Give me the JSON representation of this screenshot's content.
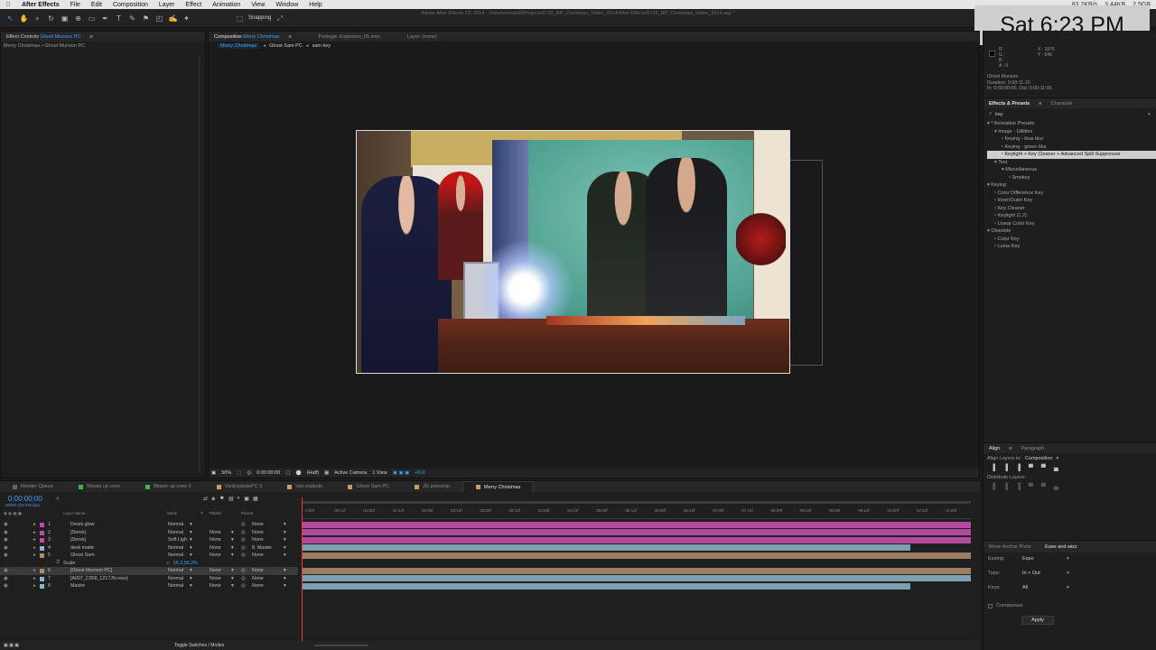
{
  "menubar": {
    "items": [
      "After Effects",
      "File",
      "Edit",
      "Composition",
      "Layer",
      "Effect",
      "Animation",
      "View",
      "Window",
      "Help"
    ],
    "tray": [
      "83.2KB/s",
      "3.44KB",
      "2.5GB"
    ]
  },
  "app": {
    "title": "Adobe After Effects CC 2014 - /Volumes/raid2/Projects/5792_RP_Christmas_Video_2014/After Effects/5792_RP_Christmas_Video_2014.aep *",
    "snapping": "Snapping"
  },
  "clock": "Sat 6:23 PM",
  "effect_controls": {
    "tab": "Effect Controls",
    "tab_sub": "Ghost Munson PC",
    "breadcrumb": "Merry Christmas • Ghost Munson PC"
  },
  "viewer": {
    "tabs": [
      {
        "label": "Composition",
        "sub": "Merry Christmas"
      },
      {
        "label": "Footage: Explosion_01.mov"
      },
      {
        "label": "Layer: (none)"
      }
    ],
    "breadcrumbs": [
      "Merry Christmas",
      "Ghost Sam PC",
      "sam key"
    ],
    "zoom": "50%",
    "timecode": "0:00:00:00",
    "resolution": "(Half)",
    "camera": "Active Camera",
    "views": "1 View",
    "exposure": "+0.0"
  },
  "info": {
    "r": "R :",
    "g": "G :",
    "b": "B :",
    "a": "A : 0",
    "x": "X : 1876",
    "y": "Y : 646",
    "layer": "Ghost Munson",
    "duration": "Duration: 0:00:11:10",
    "inout": "In: 0:00:00:00, Out: 0:00:11:09"
  },
  "effects": {
    "tabs": [
      "Effects & Presets",
      "Character"
    ],
    "search": "key",
    "tree": [
      {
        "label": "* Animation Presets",
        "level": 0,
        "open": true
      },
      {
        "label": "Image - Utilities",
        "level": 1,
        "open": true
      },
      {
        "label": "Keying - blue blur",
        "level": 2
      },
      {
        "label": "Keying - green blur",
        "level": 2
      },
      {
        "label": "Keylight + Key Cleaner + Advanced Spill Suppressor",
        "level": 2,
        "selected": true
      },
      {
        "label": "Text",
        "level": 1,
        "open": true
      },
      {
        "label": "Miscellaneous",
        "level": 2,
        "open": true
      },
      {
        "label": "Smokey",
        "level": 3
      },
      {
        "label": "Keying",
        "level": 0,
        "open": true
      },
      {
        "label": "Color Difference Key",
        "level": 1
      },
      {
        "label": "Inner/Outer Key",
        "level": 1
      },
      {
        "label": "Key Cleaner",
        "level": 1
      },
      {
        "label": "Keylight (1.2)",
        "level": 1
      },
      {
        "label": "Linear Color Key",
        "level": 1
      },
      {
        "label": "Obsolete",
        "level": 0,
        "open": true
      },
      {
        "label": "Color Key",
        "level": 1
      },
      {
        "label": "Luma Key",
        "level": 1
      }
    ]
  },
  "align": {
    "tabs": [
      "Align",
      "Paragraph"
    ],
    "align_to_label": "Align Layers to:",
    "align_to": "Composition",
    "distribute_label": "Distribute Layers:"
  },
  "ease": {
    "tabs": [
      "Move Anchor Point",
      "Ease and wizz"
    ],
    "easing_label": "Easing:",
    "easing": "Expo",
    "type_label": "Type:",
    "type": "In + Out",
    "keys_label": "Keys:",
    "keys": "All",
    "curvaceous": "Curvaceous",
    "apply": "Apply"
  },
  "timeline": {
    "tabs": [
      {
        "label": "Render Queue",
        "color": "#666666"
      },
      {
        "label": "Blowin up crew",
        "color": "#3cb44b"
      },
      {
        "label": "Blowin up crew 2",
        "color": "#3cb44b"
      },
      {
        "label": "VanExplodePC 3",
        "color": "#c8a05a"
      },
      {
        "label": "Van explode",
        "color": "#c8a05a"
      },
      {
        "label": "Ghost Sam PC",
        "color": "#c8a05a"
      },
      {
        "label": "JG precomp",
        "color": "#c8a05a"
      },
      {
        "label": "Merry Christmas",
        "color": "#c8a05a",
        "active": true
      }
    ],
    "timecode": "0:00:00:00",
    "fps": "00000 (23.976 fps)",
    "headers": {
      "layer": "Layer Name",
      "mode": "Mode",
      "t": "T",
      "trkmat": "TrkMat",
      "parent": "Parent"
    },
    "ruler": [
      "0:00f",
      "00:12f",
      "01:00f",
      "01:12f",
      "02:00f",
      "02:12f",
      "03:00f",
      "03:12f",
      "04:00f",
      "04:12f",
      "05:00f",
      "05:12f",
      "06:00f",
      "06:12f",
      "07:00f",
      "07:12f",
      "08:00f",
      "08:12f",
      "09:00f",
      "09:12f",
      "10:00f",
      "10:12f",
      "11:00f"
    ],
    "layers": [
      {
        "num": "1",
        "name": "Derek glow",
        "mode": "Normal",
        "trkmat": "",
        "parent": "None",
        "color": "#c848a8",
        "bar": "#b24aa0",
        "end": 1.0
      },
      {
        "num": "2",
        "name": "[Derek]",
        "mode": "Normal",
        "trkmat": "None",
        "parent": "None",
        "color": "#c848a8",
        "bar": "#b24aa0",
        "end": 1.0
      },
      {
        "num": "3",
        "name": "[Derek]",
        "mode": "Soft Ligh",
        "trkmat": "None",
        "parent": "None",
        "color": "#c848a8",
        "bar": "#b24aa0",
        "end": 1.0
      },
      {
        "num": "4",
        "name": "desk matte",
        "mode": "Normal",
        "trkmat": "None",
        "parent": "8. Master",
        "color": "#8fb3c8",
        "bar": "#7d9fb0",
        "end": 0.91
      },
      {
        "num": "5",
        "name": "Ghost Sam",
        "mode": "Normal",
        "trkmat": "None",
        "parent": "None",
        "color": "#b48c64",
        "bar": "#9b7d63",
        "end": 1.0
      },
      {
        "num": "",
        "name": "Scale",
        "mode": "",
        "trkmat": "",
        "parent": "",
        "color": "",
        "bar": "",
        "end": 0,
        "value": "56.2,56.2%"
      },
      {
        "num": "6",
        "name": "[Ghost Munson PC]",
        "mode": "Normal",
        "trkmat": "None",
        "parent": "None",
        "color": "#b48c64",
        "bar": "#9b7d63",
        "end": 1.0,
        "selected": true
      },
      {
        "num": "7",
        "name": "[A007_C009_1217JN.mov]",
        "mode": "Normal",
        "trkmat": "None",
        "parent": "None",
        "color": "#8fb3c8",
        "bar": "#7d9fb0",
        "end": 1.0
      },
      {
        "num": "8",
        "name": "Master",
        "mode": "Normal",
        "trkmat": "None",
        "parent": "None",
        "color": "#8fb3c8",
        "bar": "#7d9fb0",
        "end": 0.91
      }
    ],
    "toggle": "Toggle Switches / Modes"
  }
}
